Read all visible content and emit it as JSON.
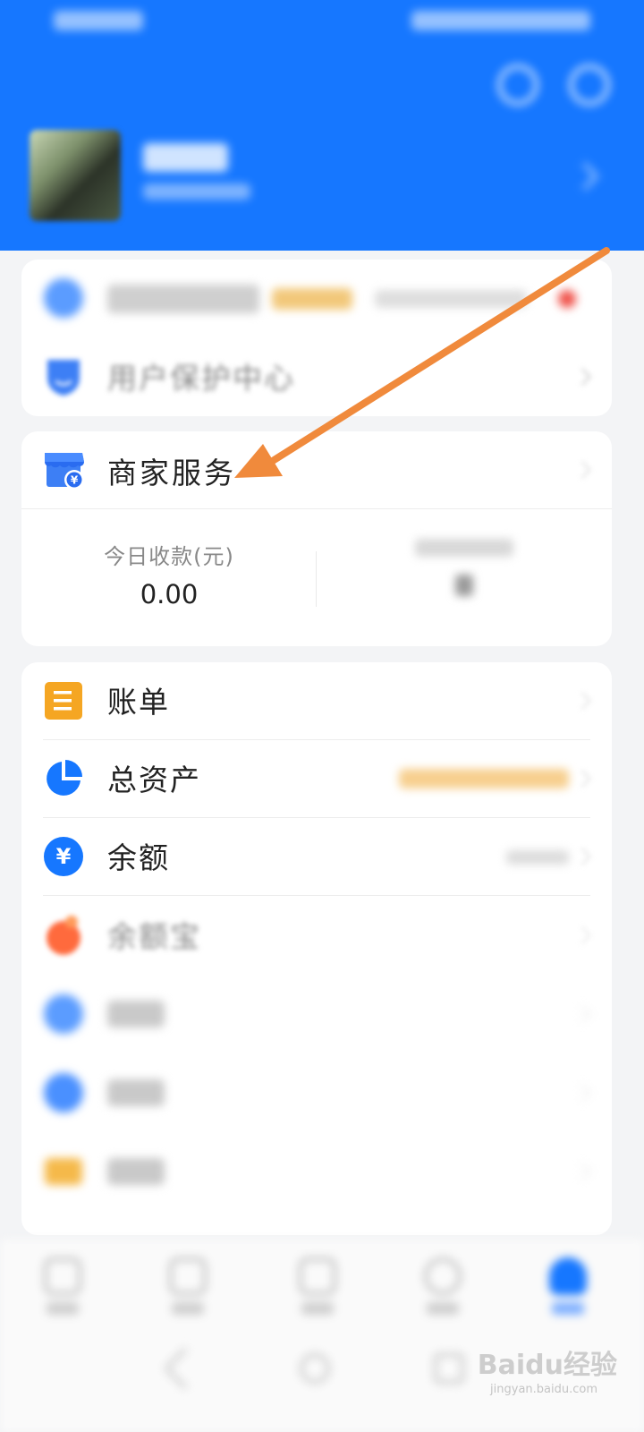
{
  "merchant": {
    "title": "商家服务",
    "stats": [
      {
        "label": "今日收款(元)",
        "value": "0.00"
      },
      {
        "label": "",
        "value": ""
      }
    ]
  },
  "top_items": [
    {
      "label": "",
      "icon": "membership-icon"
    },
    {
      "label": "用户保护中心",
      "icon": "shield-icon"
    }
  ],
  "menu": [
    {
      "label": "账单",
      "icon": "bill-icon",
      "color": "#f5a623"
    },
    {
      "label": "总资产",
      "icon": "pie-chart-icon",
      "color": "#1677ff"
    },
    {
      "label": "余额",
      "icon": "yuan-icon",
      "color": "#1677ff"
    },
    {
      "label": "余额宝",
      "icon": "yuebao-icon",
      "color": "#ff6a3d"
    },
    {
      "label": "",
      "icon": "coin-icon",
      "color": "#1677ff"
    },
    {
      "label": "",
      "icon": "flower-icon",
      "color": "#1677ff"
    },
    {
      "label": "",
      "icon": "card-icon",
      "color": "#f5b94a"
    }
  ],
  "watermark": {
    "logo": "Baidu经验",
    "url": "jingyan.baidu.com"
  },
  "colors": {
    "brand": "#1677ff",
    "annotation_arrow": "#f08a3c"
  }
}
